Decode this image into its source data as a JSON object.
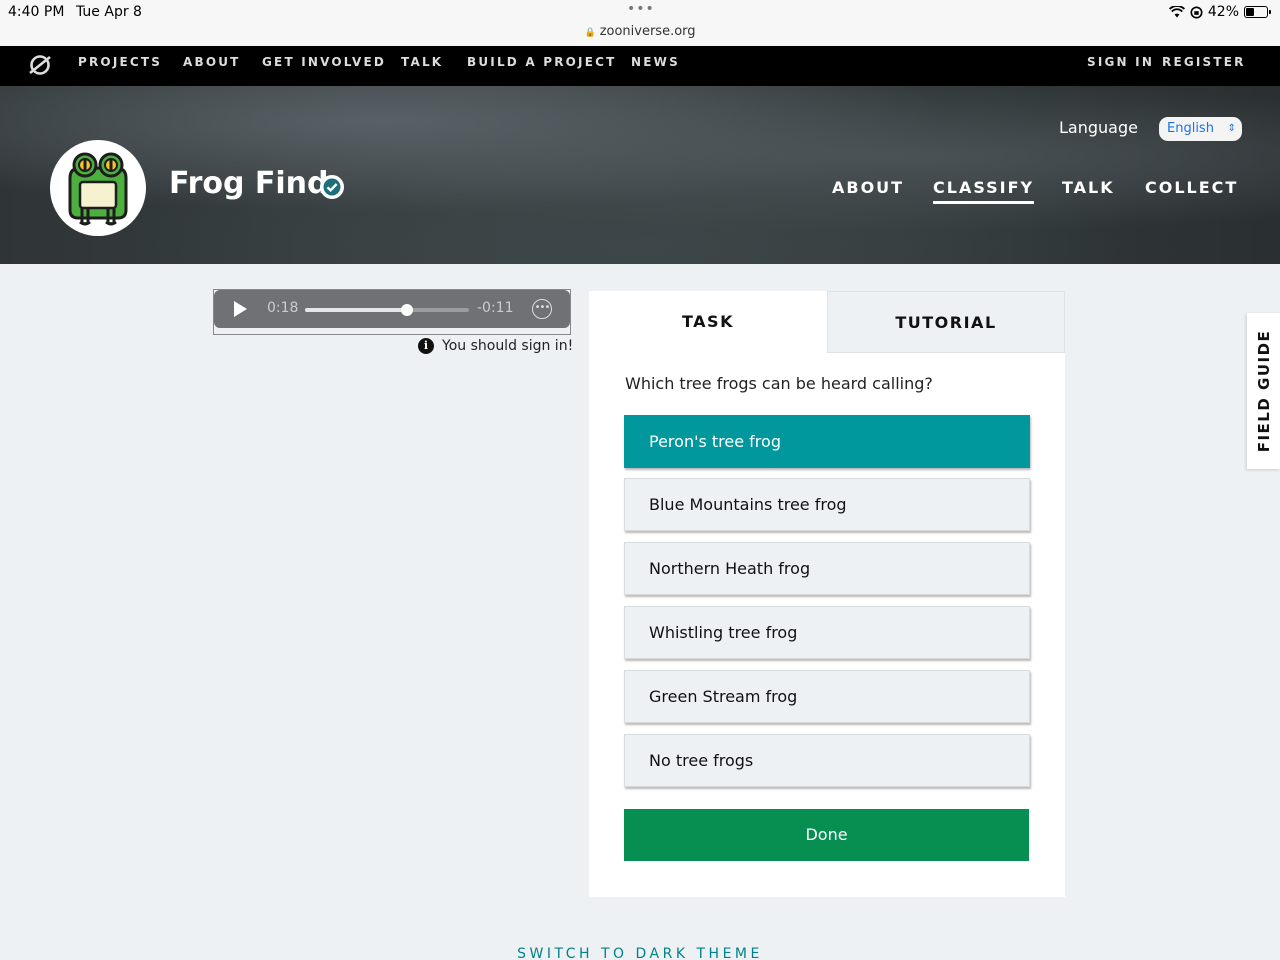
{
  "status_bar": {
    "time": "4:40 PM",
    "date": "Tue Apr 8",
    "url": "zooniverse.org",
    "battery": "42%",
    "battery_fraction": 0.42
  },
  "top_nav": {
    "items": [
      "PROJECTS",
      "ABOUT",
      "GET INVOLVED",
      "TALK",
      "BUILD A PROJECT",
      "NEWS"
    ],
    "sign_in": "SIGN IN",
    "register": "REGISTER"
  },
  "project": {
    "title": "Frog Find",
    "language_label": "Language",
    "language_value": "English",
    "nav": [
      "ABOUT",
      "CLASSIFY",
      "TALK",
      "COLLECT"
    ],
    "active_nav": "CLASSIFY"
  },
  "audio": {
    "elapsed": "0:18",
    "remaining": "-0:11",
    "progress_fraction": 0.62,
    "sign_in_note": "You should sign in!"
  },
  "task_panel": {
    "tabs": [
      "TASK",
      "TUTORIAL"
    ],
    "question": "Which tree frogs can be heard calling?",
    "answers": [
      {
        "label": "Peron's tree frog",
        "selected": true
      },
      {
        "label": "Blue Mountains tree frog",
        "selected": false
      },
      {
        "label": "Northern Heath frog",
        "selected": false
      },
      {
        "label": "Whistling tree frog",
        "selected": false
      },
      {
        "label": "Green Stream frog",
        "selected": false
      },
      {
        "label": "No tree frogs",
        "selected": false
      }
    ],
    "done_label": "Done"
  },
  "field_guide_label": "FIELD GUIDE",
  "theme_toggle": "SWITCH TO DARK THEME",
  "colors": {
    "selected_answer": "#00979d",
    "done_button": "#078f52",
    "theme_link": "#00828a",
    "language_text": "#1a73e8"
  }
}
